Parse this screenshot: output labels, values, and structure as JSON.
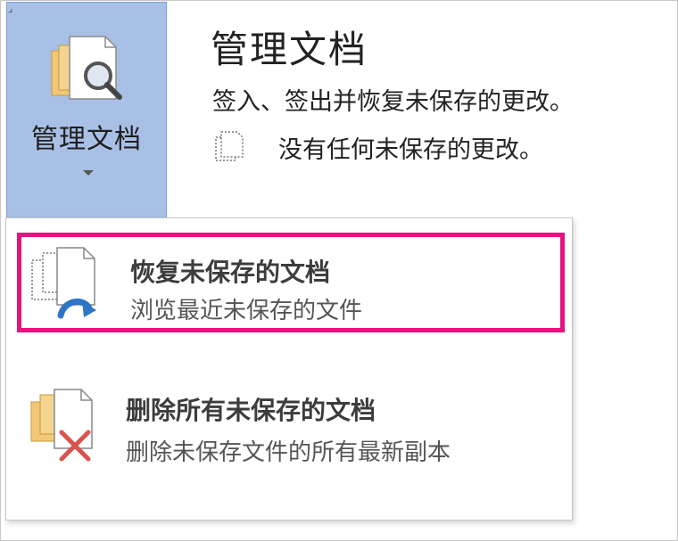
{
  "manage_button": {
    "label": "管理文档",
    "icon": "manage-document-icon"
  },
  "header": {
    "title": "管理文档",
    "description": "签入、签出并恢复未保存的更改。",
    "status_text": "没有任何未保存的更改。",
    "status_icon": "document-dotted-icon"
  },
  "menu": {
    "items": [
      {
        "title": "恢复未保存的文档",
        "description": "浏览最近未保存的文件",
        "icon": "recover-document-icon",
        "highlighted": true
      },
      {
        "title": "删除所有未保存的文档",
        "description": "删除未保存文件的所有最新副本",
        "icon": "delete-documents-icon",
        "highlighted": false
      }
    ]
  },
  "colors": {
    "button_bg": "#a9c0e6",
    "highlight_border": "#e5137f",
    "delete_x": "#d9534f",
    "arrow_blue": "#2e75c7"
  }
}
